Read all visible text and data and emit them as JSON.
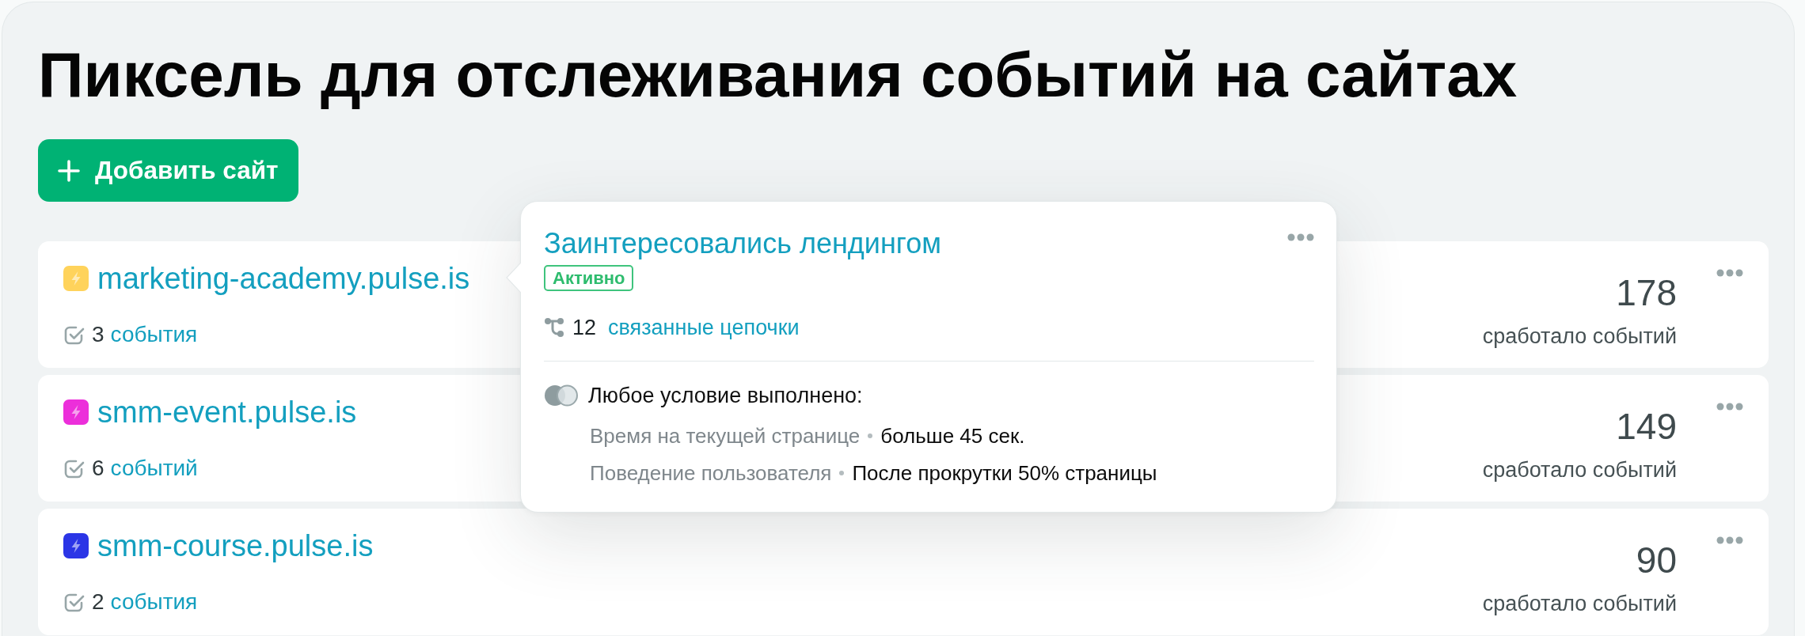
{
  "page": {
    "title": "Пиксель для отслеживания событий на сайтах"
  },
  "add_button": {
    "label": "Добавить сайт"
  },
  "sites": [
    {
      "domain": "marketing-academy.pulse.is",
      "color": "#ffd35b",
      "events_count": "3",
      "events_label": "события",
      "fired_count": "178",
      "fired_label": "сработало событий"
    },
    {
      "domain": "smm-event.pulse.is",
      "color": "#ec2fda",
      "events_count": "6",
      "events_label": "событий",
      "fired_count": "149",
      "fired_label": "сработало событий"
    },
    {
      "domain": "smm-course.pulse.is",
      "color": "#2b35e6",
      "events_count": "2",
      "events_label": "события",
      "fired_count": "90",
      "fired_label": "сработало событий"
    }
  ],
  "popover": {
    "title": "Заинтересовались лендингом",
    "status": {
      "label": "Активно",
      "active": true
    },
    "chains_count": "12",
    "chains_label": "связанные цепочки",
    "condition_title": "Любое условие выполнено:",
    "conditions": [
      {
        "name": "Время на текущей странице",
        "value": "больше 45 сек."
      },
      {
        "name": "Поведение пользователя",
        "value": "После прокрутки 50% страницы"
      }
    ]
  }
}
